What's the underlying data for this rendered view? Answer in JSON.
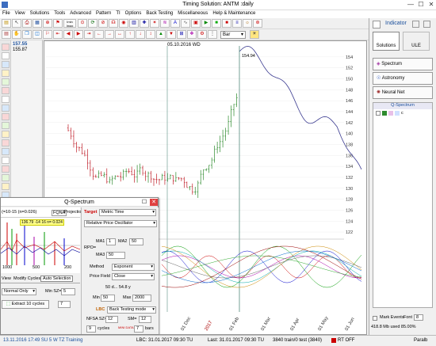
{
  "window": {
    "title": "Timing Solution:  ANTM  :daily",
    "minimize": "—",
    "maximize": "☐",
    "close": "✕"
  },
  "menu": [
    "File",
    "View",
    "Solutions",
    "Tools",
    "Advanced",
    "Pattern",
    "TI",
    "Options",
    "Back Testing",
    "Miscellaneous",
    "Help & Maintenance"
  ],
  "toolbar": {
    "minmax": "Imin\nImax",
    "chart_style": "Bar",
    "indicator_label": "Indicator"
  },
  "chart": {
    "date_label": "05.10.2016 WD",
    "price_top_left": "157.55",
    "price_second": "155.87",
    "price_label_right": "154.94",
    "price_ticks": [
      "154",
      "152",
      "150",
      "148",
      "146",
      "144",
      "142",
      "140",
      "138",
      "136",
      "134",
      "132",
      "130",
      "128",
      "126",
      "124",
      "122"
    ],
    "date_ticks": [
      "01 Dec",
      "2017",
      "01 Feb",
      "01 Mar",
      "01 Apr",
      "01 May",
      "01 Jun"
    ]
  },
  "right_panel": {
    "tabs": [
      "Solutions",
      "ULE"
    ],
    "buttons": [
      "Spectrum",
      "Astronomy",
      "Neural Net"
    ],
    "list_header": "Q-Spectrum",
    "list_item": "c",
    "mark_events_label": "Mark Events",
    "font_label": "Font",
    "font_value": "8",
    "memory": "418.8 Mb used 85.00%"
  },
  "qspectrum": {
    "title": "Q-Spectrum",
    "range_text": "(=10-15 (n=0.026)",
    "tab1": "FQNA",
    "tab2": "Projection",
    "target_label": "Target",
    "target_value": "Metric Time",
    "oscillator": "Relative Price Oscillator",
    "ma1_label": "MA1",
    "ma1_value": "1",
    "ma2_label": "MA2",
    "ma2_value": "50",
    "rpo_label": "RPO=",
    "ma3_label": "MA3",
    "ma3_value": "50",
    "method_label": "Method",
    "method_value": "Exponent",
    "pricefield_label": "Price Field",
    "pricefield_value": "Close",
    "period_text": "50 d...    54.8 y",
    "min_label": "Min",
    "min_value": "50",
    "max_label": "Max",
    "max_value": "2000",
    "lbc_label": "LBC",
    "backtest_value": "Back Testing mode",
    "nfsa_label": "NFSA SZ=",
    "nfsa_value": "12",
    "sm_label": "SM=",
    "sm_value": "12",
    "cycles_value": "9",
    "cycles_label": "cycles",
    "bars_value": "7",
    "bars_label": "bars",
    "sub_tabs": [
      "View",
      "Modify Cycles",
      "Auto Selection"
    ],
    "normal_only": "Normal Only",
    "min_sz_label": "Min SZ=",
    "min_sz_value": "5",
    "extract_button": "Extract 10 cycles",
    "spinner_value": "7",
    "legend_values": [
      "136.79",
      "-14",
      "16",
      "n=",
      "0.024"
    ],
    "spectrum_ticks": [
      "1000",
      "500",
      "200"
    ],
    "info_text": "MINI DATA"
  },
  "status": {
    "datetime": "13.11.2016  17:49 SU   5 W TZ  Training",
    "lbc": "LBC: 31.01.2017  09:30 TU",
    "last": "Last: 31.01.2017  09:30 TU",
    "train": "3840 train/0 test (3840)",
    "rt": "RT OFF",
    "pareto": "Paralb"
  },
  "colors": {
    "up_bar": "#2e8b2e",
    "down_bar": "#c0202a",
    "projection": "#3a3a90",
    "accent": "#1a4f9c"
  }
}
